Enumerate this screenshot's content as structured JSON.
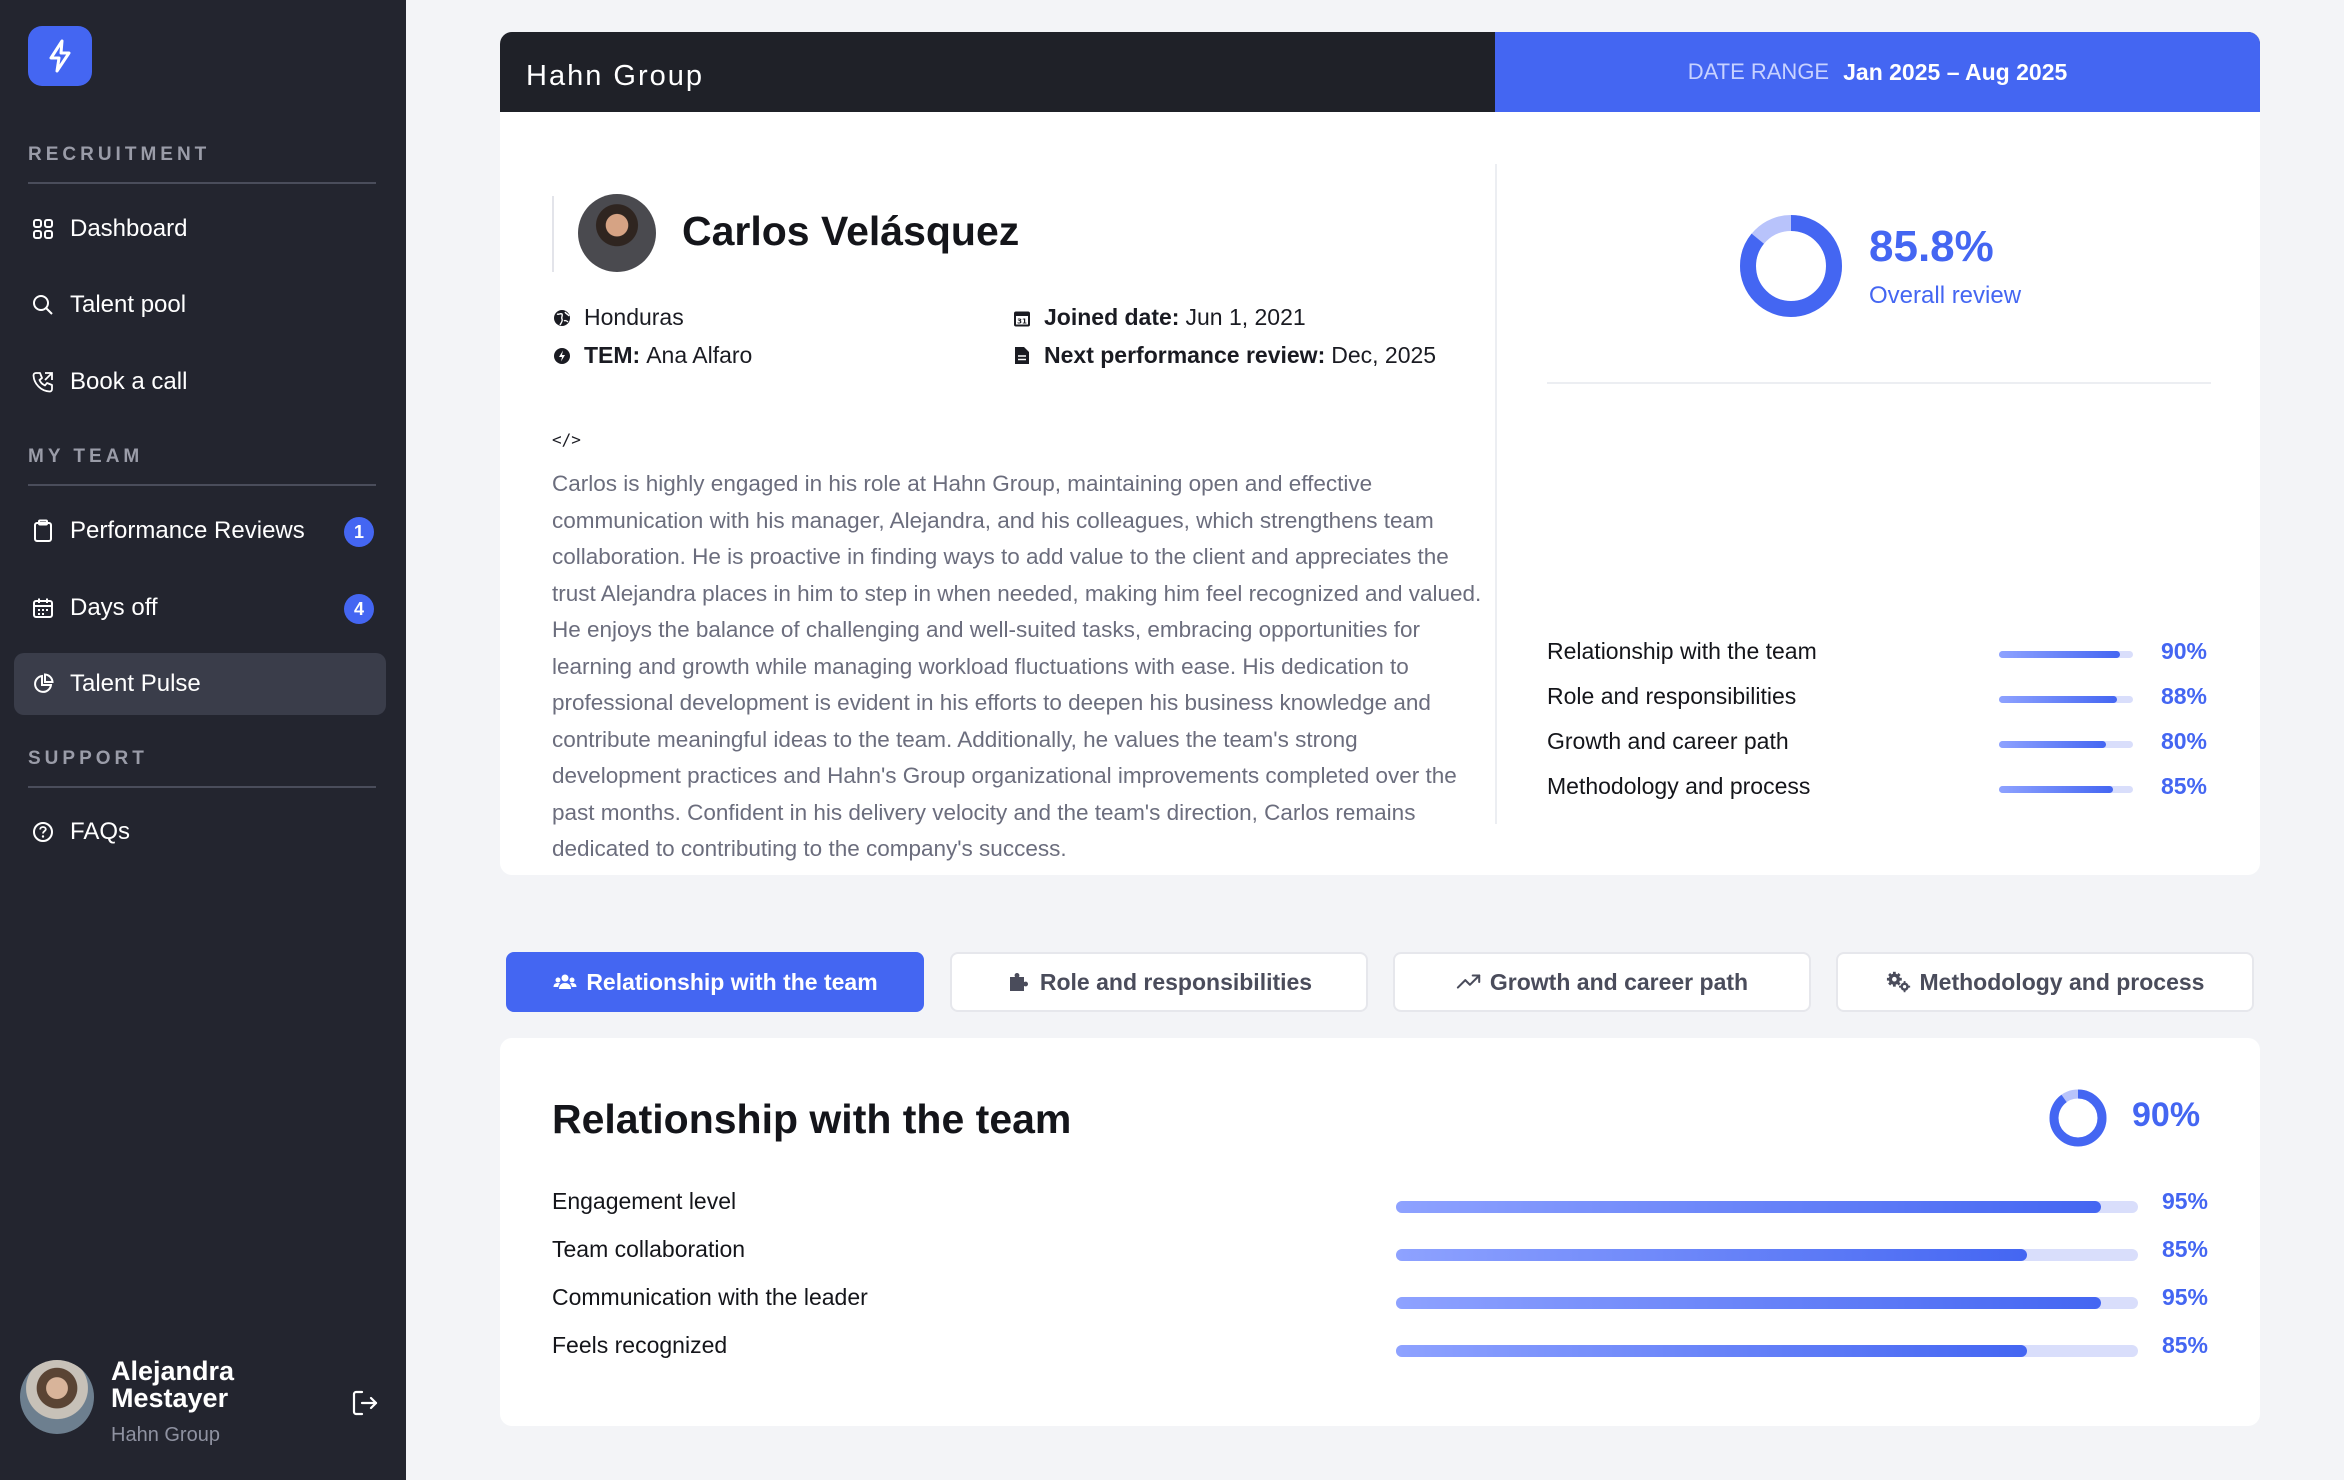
{
  "sidebar": {
    "sections": {
      "recruitment": "RECRUITMENT",
      "my_team": "MY TEAM",
      "support": "SUPPORT"
    },
    "items": [
      {
        "label": "Dashboard",
        "icon": "grid-icon"
      },
      {
        "label": "Talent pool",
        "icon": "search-icon"
      },
      {
        "label": "Book a call",
        "icon": "phone-icon"
      },
      {
        "label": "Performance Reviews",
        "icon": "clipboard-icon",
        "badge": "1"
      },
      {
        "label": "Days off",
        "icon": "calendar-icon",
        "badge": "4"
      },
      {
        "label": "Talent Pulse",
        "icon": "pie-chart-icon",
        "active": true
      },
      {
        "label": "FAQs",
        "icon": "help-circle-icon"
      }
    ],
    "user": {
      "name": "Alejandra Mestayer",
      "org": "Hahn Group"
    }
  },
  "header": {
    "company": "Hahn Group",
    "date_range_label": "DATE RANGE",
    "date_range_value": "Jan 2025 – Aug 2025"
  },
  "profile": {
    "name": "Carlos Velásquez",
    "country": "Honduras",
    "tem_label": "TEM:",
    "tem_value": "Ana Alfaro",
    "joined_label": "Joined date:",
    "joined_value": "Jun 1, 2021",
    "review_label": "Next performance review:",
    "review_value": "Dec, 2025",
    "summary": "Carlos is highly engaged in his role at Hahn Group, maintaining open and effective communication with his manager, Alejandra, and his colleagues, which strengthens team collaboration. He is proactive in finding ways to add value to the client and appreciates the trust Alejandra places in him to step in when needed, making him feel recognized and valued. He enjoys the balance of challenging and well-suited tasks, embracing opportunities for learning and growth while managing workload fluctuations with ease. His dedication to professional development is evident in his efforts to deepen his business knowledge and contribute meaningful ideas to the team. Additionally, he values the team's strong development practices and Hahn's Group organizational improvements completed over the past months. Confident in his delivery velocity and the team's direction, Carlos remains dedicated to contributing to the company's success."
  },
  "overall": {
    "pct": "85.8%",
    "value": 85.8,
    "label": "Overall review"
  },
  "categories": [
    {
      "label": "Relationship with the team",
      "pct": "90%",
      "value": 90
    },
    {
      "label": "Role and responsibilities",
      "pct": "88%",
      "value": 88
    },
    {
      "label": "Growth and career path",
      "pct": "80%",
      "value": 80
    },
    {
      "label": "Methodology and process",
      "pct": "85%",
      "value": 85
    }
  ],
  "tabs": [
    {
      "label": "Relationship with the team",
      "icon": "users-icon",
      "active": true
    },
    {
      "label": "Role and responsibilities",
      "icon": "puzzle-icon"
    },
    {
      "label": "Growth and career path",
      "icon": "trending-up-icon"
    },
    {
      "label": "Methodology and process",
      "icon": "gears-icon"
    }
  ],
  "detail": {
    "title": "Relationship with the team",
    "pct": "90%",
    "value": 90,
    "items": [
      {
        "label": "Engagement level",
        "pct": "95%",
        "value": 95
      },
      {
        "label": "Team collaboration",
        "pct": "85%",
        "value": 85
      },
      {
        "label": "Communication with the leader",
        "pct": "95%",
        "value": 95
      },
      {
        "label": "Feels recognized",
        "pct": "85%",
        "value": 85
      }
    ]
  },
  "colors": {
    "accent": "#4466f2",
    "sidebar_bg": "#23252f",
    "header_bg": "#1f2128"
  }
}
